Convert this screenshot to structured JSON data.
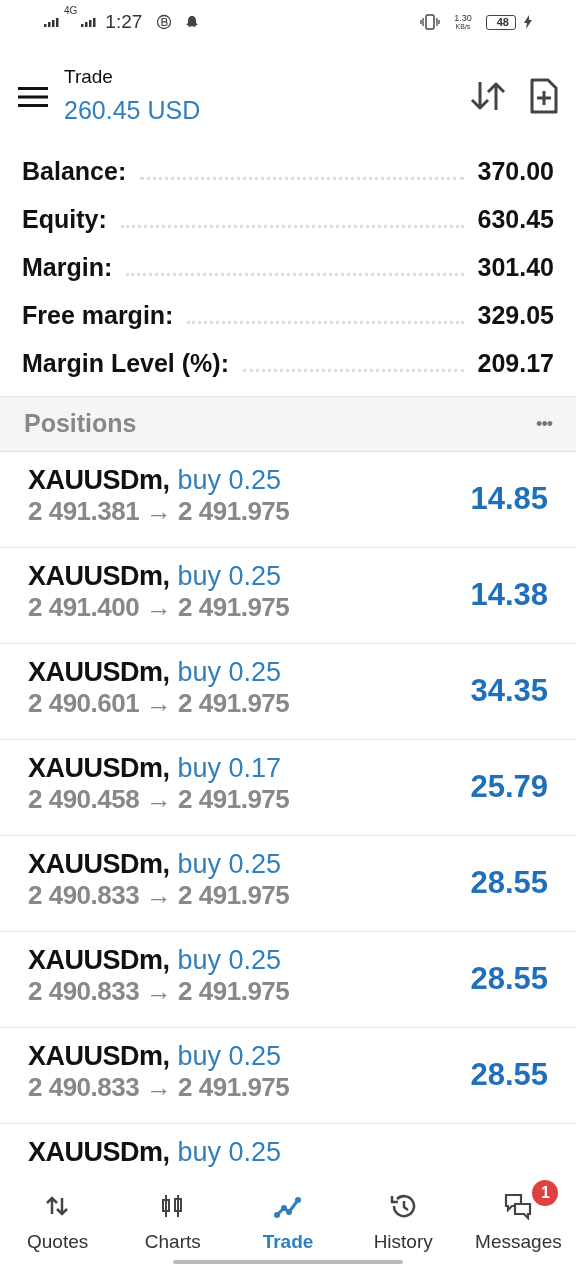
{
  "status_bar": {
    "network": "4G",
    "time": "1:27",
    "speed": "1.30",
    "speed_unit": "KB/s",
    "battery": "48"
  },
  "header": {
    "title": "Trade",
    "subtitle": "260.45 USD"
  },
  "summary": [
    {
      "label": "Balance:",
      "value": "370.00"
    },
    {
      "label": "Equity:",
      "value": "630.45"
    },
    {
      "label": "Margin:",
      "value": "301.40"
    },
    {
      "label": "Free margin:",
      "value": "329.05"
    },
    {
      "label": "Margin Level (%):",
      "value": "209.17"
    }
  ],
  "positions_header": {
    "title": "Positions",
    "menu": "•••"
  },
  "positions": [
    {
      "symbol": "XAUUSDm,",
      "side": "buy 0.25",
      "prices": "2 491.381 → 2 491.975",
      "profit": "14.85"
    },
    {
      "symbol": "XAUUSDm,",
      "side": "buy 0.25",
      "prices": "2 491.400 → 2 491.975",
      "profit": "14.38"
    },
    {
      "symbol": "XAUUSDm,",
      "side": "buy 0.25",
      "prices": "2 490.601 → 2 491.975",
      "profit": "34.35"
    },
    {
      "symbol": "XAUUSDm,",
      "side": "buy 0.17",
      "prices": "2 490.458 → 2 491.975",
      "profit": "25.79"
    },
    {
      "symbol": "XAUUSDm,",
      "side": "buy 0.25",
      "prices": "2 490.833 → 2 491.975",
      "profit": "28.55"
    },
    {
      "symbol": "XAUUSDm,",
      "side": "buy 0.25",
      "prices": "2 490.833 → 2 491.975",
      "profit": "28.55"
    },
    {
      "symbol": "XAUUSDm,",
      "side": "buy 0.25",
      "prices": "2 490.833 → 2 491.975",
      "profit": "28.55"
    },
    {
      "symbol": "XAUUSDm,",
      "side": "buy 0.25"
    }
  ],
  "bottom_nav": [
    {
      "kind": "quotes",
      "label": "Quotes",
      "selected": false
    },
    {
      "kind": "charts",
      "label": "Charts",
      "selected": false
    },
    {
      "kind": "trade",
      "label": "Trade",
      "selected": true
    },
    {
      "kind": "history",
      "label": "History",
      "selected": false
    },
    {
      "kind": "messages",
      "label": "Messages",
      "selected": false,
      "badge": "1"
    }
  ]
}
